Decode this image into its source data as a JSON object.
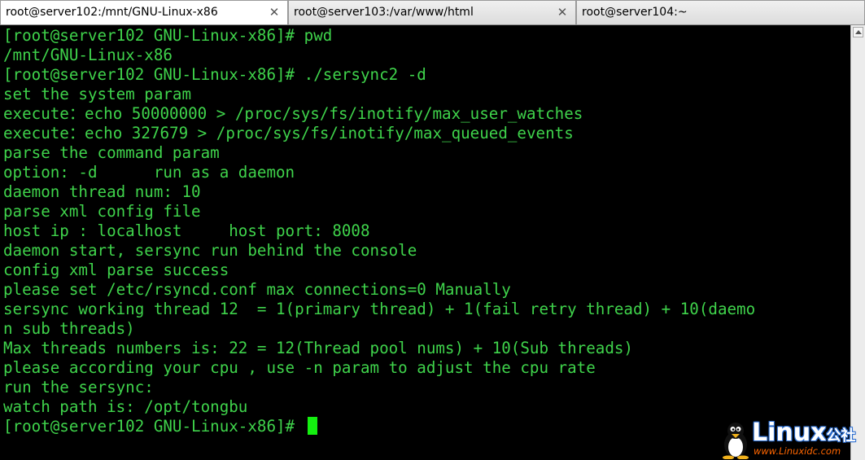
{
  "tabs": [
    {
      "title": "root@server102:/mnt/GNU-Linux-x86",
      "close": "✕",
      "active": true
    },
    {
      "title": "root@server103:/var/www/html",
      "close": "✕",
      "active": false
    },
    {
      "title": "root@server104:~",
      "close": "",
      "active": false
    }
  ],
  "terminal": {
    "lines": [
      "[root@server102 GNU-Linux-x86]# pwd",
      "/mnt/GNU-Linux-x86",
      "[root@server102 GNU-Linux-x86]# ./sersync2 -d",
      "set the system param",
      "execute：echo 50000000 > /proc/sys/fs/inotify/max_user_watches",
      "execute：echo 327679 > /proc/sys/fs/inotify/max_queued_events",
      "parse the command param",
      "option: -d      run as a daemon",
      "daemon thread num: 10",
      "parse xml config file",
      "host ip : localhost     host port: 8008",
      "daemon start, sersync run behind the console",
      "config xml parse success",
      "please set /etc/rsyncd.conf max connections=0 Manually",
      "sersync working thread 12  = 1(primary thread) + 1(fail retry thread) + 10(daemo",
      "n sub threads)",
      "Max threads numbers is: 22 = 12(Thread pool nums) + 10(Sub threads)",
      "please according your cpu , use -n param to adjust the cpu rate",
      "run the sersync:",
      "watch path is: /opt/tongbu",
      "[root@server102 GNU-Linux-x86]# "
    ],
    "text_color": "#3fd34b",
    "cursor_color": "#14ef10"
  },
  "watermark": {
    "brand": "Linux",
    "brand_cn": "公社",
    "url": "www.Linuxidc.com"
  }
}
